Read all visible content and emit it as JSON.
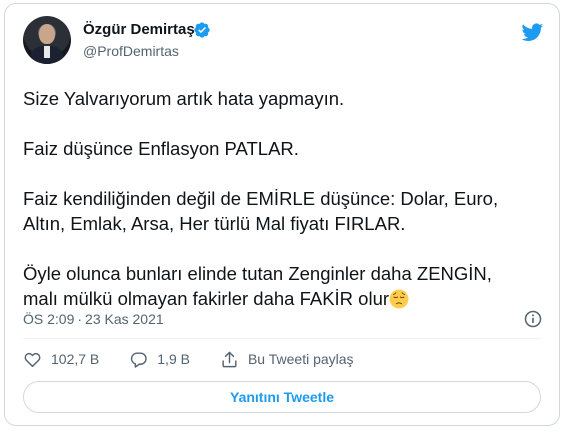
{
  "tweet": {
    "author_name": "Özgür Demirtaş",
    "author_handle": "@ProfDemirtas",
    "paragraphs": [
      "Size Yalvarıyorum artık hata yapmayın.",
      "Faiz düşünce Enflasyon PATLAR.",
      "Faiz kendiliğinden değil de EMİRLE düşünce: Dolar, Euro, Altın, Emlak, Arsa, Her türlü Mal fiyatı FIRLAR."
    ],
    "last_paragraph_line1": "Öyle olunca bunları elinde tutan Zenginler daha ZENGİN,",
    "last_paragraph_line2": "malı mülkü olmayan fakirler daha FAKİR olur",
    "time": "ÖS 2:09",
    "separator": "·",
    "date": "23 Kas 2021",
    "likes": "102,7 B",
    "replies": "1,9 B",
    "share_label": "Bu Tweeti paylaş",
    "reply_button_label": "Yanıtını Tweetle",
    "emoji": "pensive-face",
    "colors": {
      "accent": "#1d9bf0",
      "text": "#0f1419",
      "secondary": "#536471",
      "border": "#cfd9de"
    }
  }
}
